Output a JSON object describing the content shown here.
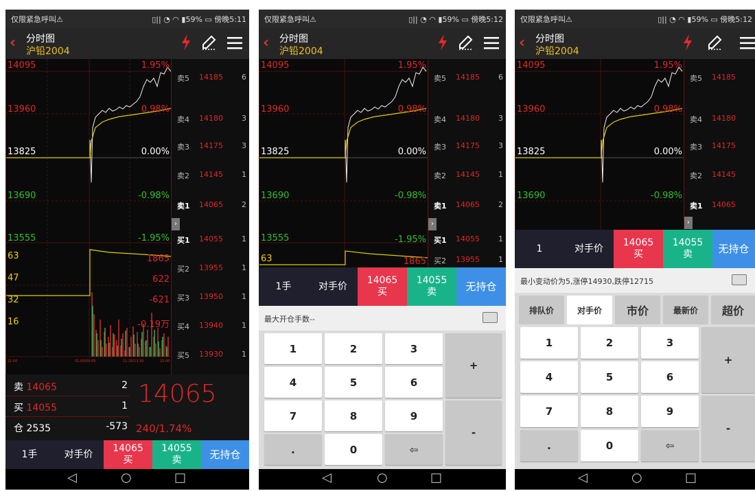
{
  "status_bar": {
    "left": "仅限紧急呼叫⚠",
    "right_p1": "▯|| ◔ ◠ ▮59% ▭ 傍晚5:11",
    "right_p2": "▯|| ◔ ◠ ▮59% ▭ 傍晚5:12",
    "right_p3": "▯|| ◔ ◠ ▮59% ▭ 傍晚5:12"
  },
  "header": {
    "back": "‹",
    "title": "分时图",
    "subtitle": "沪铅2004"
  },
  "chart": {
    "price_labels": [
      "14095",
      "13960",
      "13825",
      "13690",
      "13555"
    ],
    "pct_labels": [
      "1.95%",
      "0.98%",
      "0.00%",
      "-0.98%",
      "-1.95%"
    ],
    "vol_labels": [
      "63",
      "47",
      "32",
      "16"
    ],
    "vol_right": [
      "1865",
      "622",
      "-621",
      "-0.19万"
    ],
    "time_labels": [
      "21:00",
      "01:00/09:00",
      "11:30/13:30",
      "15:00"
    ]
  },
  "chart_data": {
    "type": "line",
    "title": "",
    "ylim": [
      13555,
      14095
    ],
    "series": [
      {
        "values": [
          13825,
          13825,
          13825,
          13825,
          13825,
          13640,
          13905,
          13925,
          13935,
          13955,
          13960,
          13950,
          13962,
          13955,
          13958,
          13965,
          13968,
          13975,
          13972,
          13980,
          14000,
          14025,
          14040,
          14055,
          14035,
          14060,
          14075,
          14080,
          14070,
          14095
        ]
      },
      {
        "values": [
          13825,
          13825,
          13825,
          13825,
          13825,
          13820,
          13870,
          13890,
          13900,
          13910,
          13915,
          13918,
          13921,
          13924,
          13928,
          13932,
          13936,
          13940,
          13945,
          13950,
          13955,
          13960,
          13962,
          13964,
          13966,
          13968,
          13969,
          13970,
          13971,
          13972
        ]
      }
    ]
  },
  "book": {
    "asks": [
      {
        "name": "卖5",
        "price": "14185",
        "qty": "6"
      },
      {
        "name": "卖4",
        "price": "14180",
        "qty": "3"
      },
      {
        "name": "卖3",
        "price": "14175",
        "qty": "3"
      },
      {
        "name": "卖2",
        "price": "14145",
        "qty": "1"
      },
      {
        "name": "卖1",
        "price": "14065",
        "qty": "2"
      }
    ],
    "bids": [
      {
        "name": "买1",
        "price": "14055",
        "qty": "1"
      },
      {
        "name": "买2",
        "price": "13955",
        "qty": "1"
      },
      {
        "name": "买3",
        "price": "13950",
        "qty": "1"
      },
      {
        "name": "买4",
        "price": "13940",
        "qty": "1"
      },
      {
        "name": "买5",
        "price": "13930",
        "qty": "1"
      }
    ],
    "collapse": "›"
  },
  "quote": {
    "sell_label": "卖 ",
    "sell_price": "14065",
    "sell_qty": "2",
    "buy_label": "买 ",
    "buy_price": "14055",
    "buy_qty": "1",
    "oi_label": "仓 2535",
    "oi_change": "-573",
    "last": "14065",
    "change": "240/1.74%"
  },
  "trade": {
    "lot_p1": "1手",
    "lot_p2": "1手",
    "lot_p3": "1",
    "price_mode": "对手价",
    "buy_price": "14065",
    "buy_label": "买",
    "sell_price": "14055",
    "sell_label": "卖",
    "position": "无持仓"
  },
  "hint_p2": "最大开仓手数--",
  "hint_p3": "最小变动价为5,涨停14930,跌停12715",
  "price_tabs": [
    "排队价",
    "对手价",
    "市价",
    "最新价",
    "超价"
  ],
  "keys": [
    "1",
    "2",
    "3",
    "4",
    "5",
    "6",
    "7",
    "8",
    "9",
    ".",
    "0",
    "⇦",
    "+",
    "-"
  ],
  "nav": {
    "back": "◁",
    "home": "○",
    "recent": "□"
  }
}
